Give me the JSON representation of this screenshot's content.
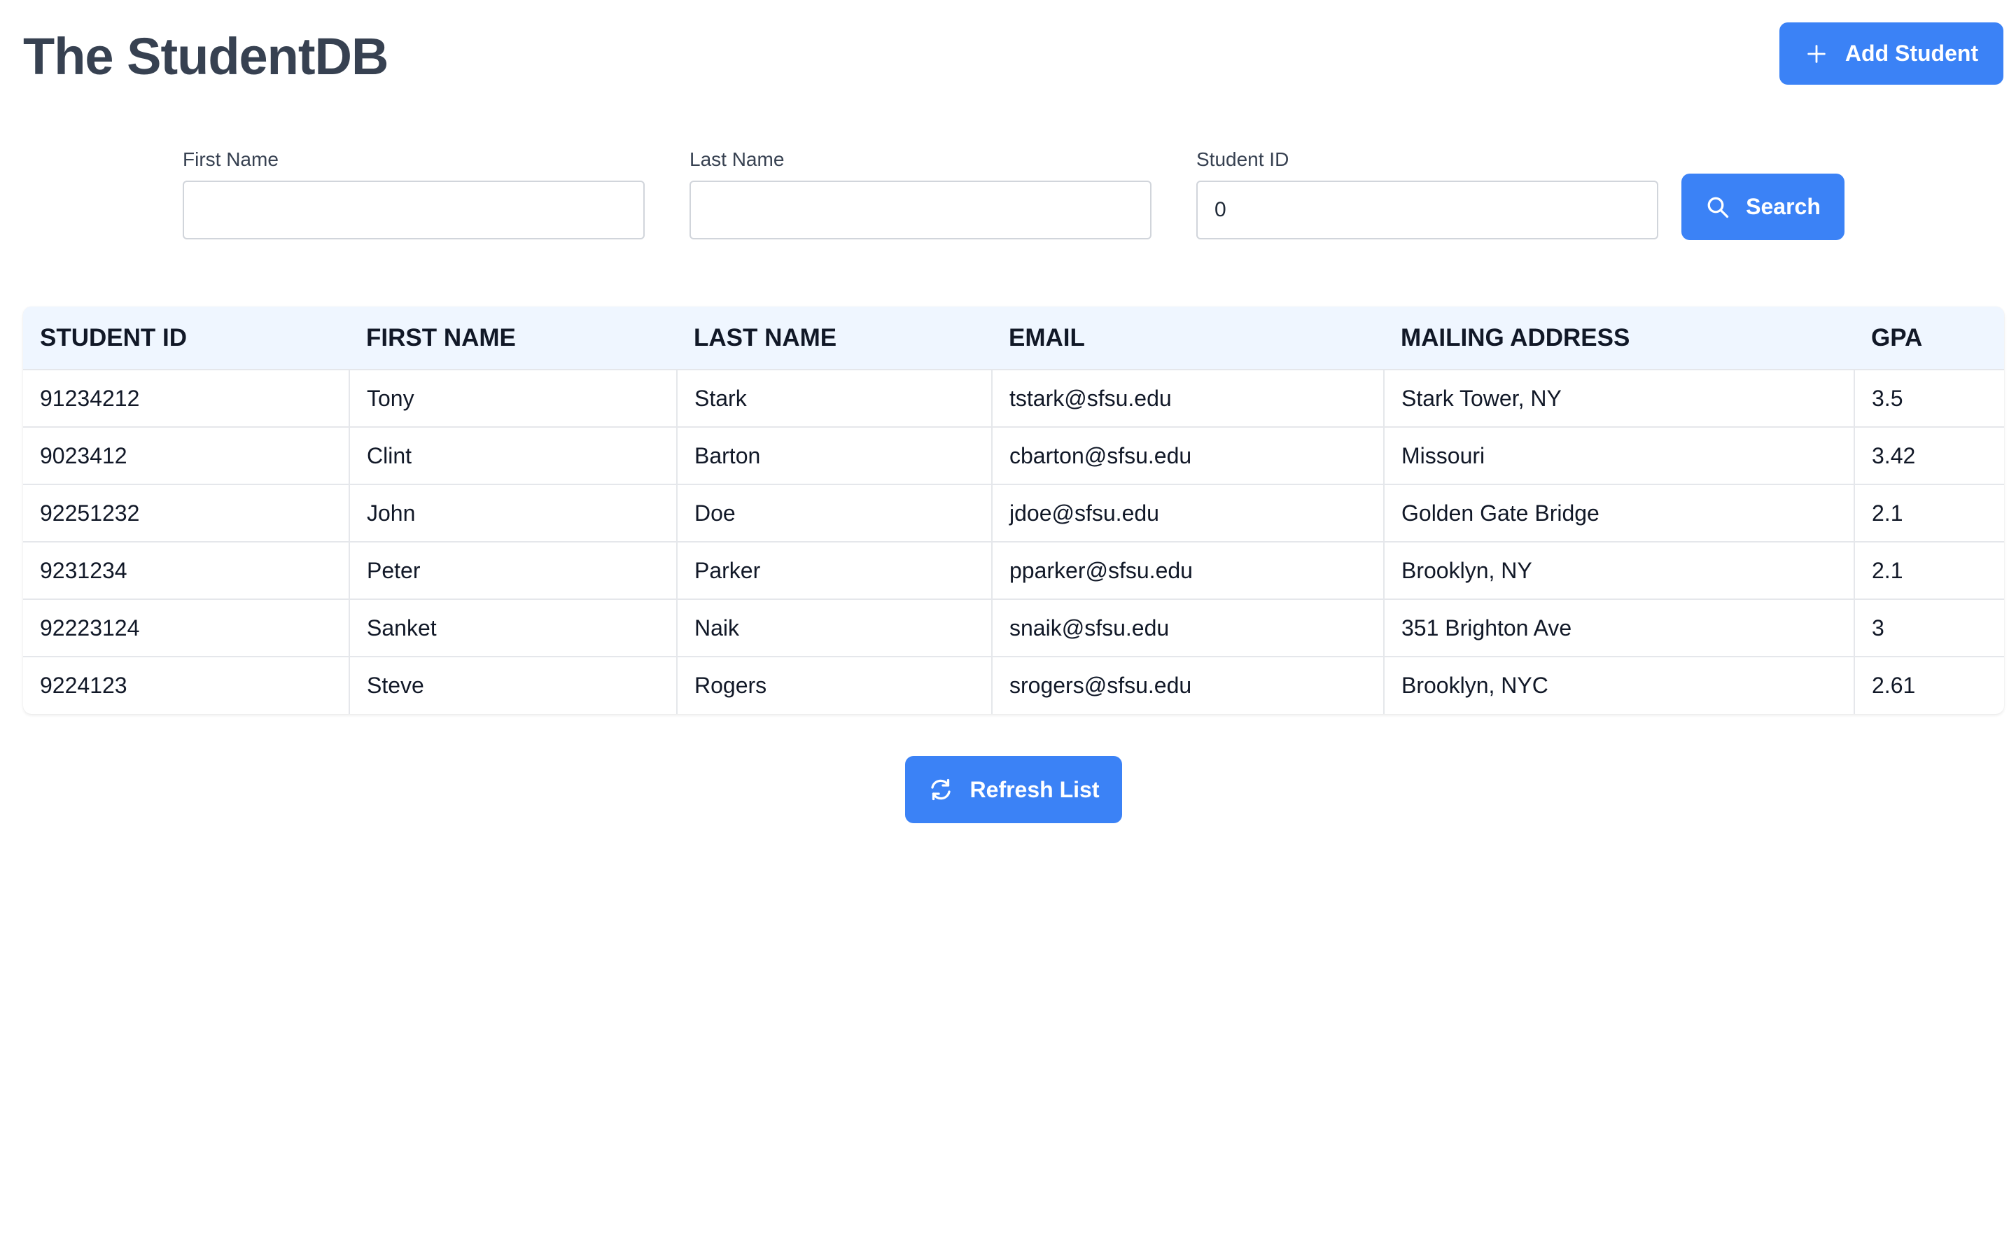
{
  "app": {
    "title": "The StudentDB"
  },
  "header": {
    "add_button_label": "Add Student",
    "add_button_icon": "plus-icon"
  },
  "search_form": {
    "first_name": {
      "label": "First Name",
      "value": "",
      "placeholder": ""
    },
    "last_name": {
      "label": "Last Name",
      "value": "",
      "placeholder": ""
    },
    "student_id": {
      "label": "Student ID",
      "value": "0",
      "placeholder": ""
    },
    "search_button_label": "Search",
    "search_button_icon": "search-icon"
  },
  "table": {
    "columns": [
      "STUDENT ID",
      "FIRST NAME",
      "LAST NAME",
      "EMAIL",
      "MAILING ADDRESS",
      "GPA"
    ],
    "rows": [
      [
        "91234212",
        "Tony",
        "Stark",
        "tstark@sfsu.edu",
        "Stark Tower, NY",
        "3.5"
      ],
      [
        "9023412",
        "Clint",
        "Barton",
        "cbarton@sfsu.edu",
        "Missouri",
        "3.42"
      ],
      [
        "92251232",
        "John",
        "Doe",
        "jdoe@sfsu.edu",
        "Golden Gate Bridge",
        "2.1"
      ],
      [
        "9231234",
        "Peter",
        "Parker",
        "pparker@sfsu.edu",
        "Brooklyn, NY",
        "2.1"
      ],
      [
        "92223124",
        "Sanket",
        "Naik",
        "snaik@sfsu.edu",
        "351 Brighton Ave",
        "3"
      ],
      [
        "9224123",
        "Steve",
        "Rogers",
        "srogers@sfsu.edu",
        "Brooklyn, NYC",
        "2.61"
      ]
    ]
  },
  "footer": {
    "refresh_button_label": "Refresh List",
    "refresh_button_icon": "refresh-icon"
  },
  "colors": {
    "primary": "#3b82f6",
    "title": "#374151",
    "table_header_bg": "#eff6ff",
    "border": "#e5e7eb"
  }
}
